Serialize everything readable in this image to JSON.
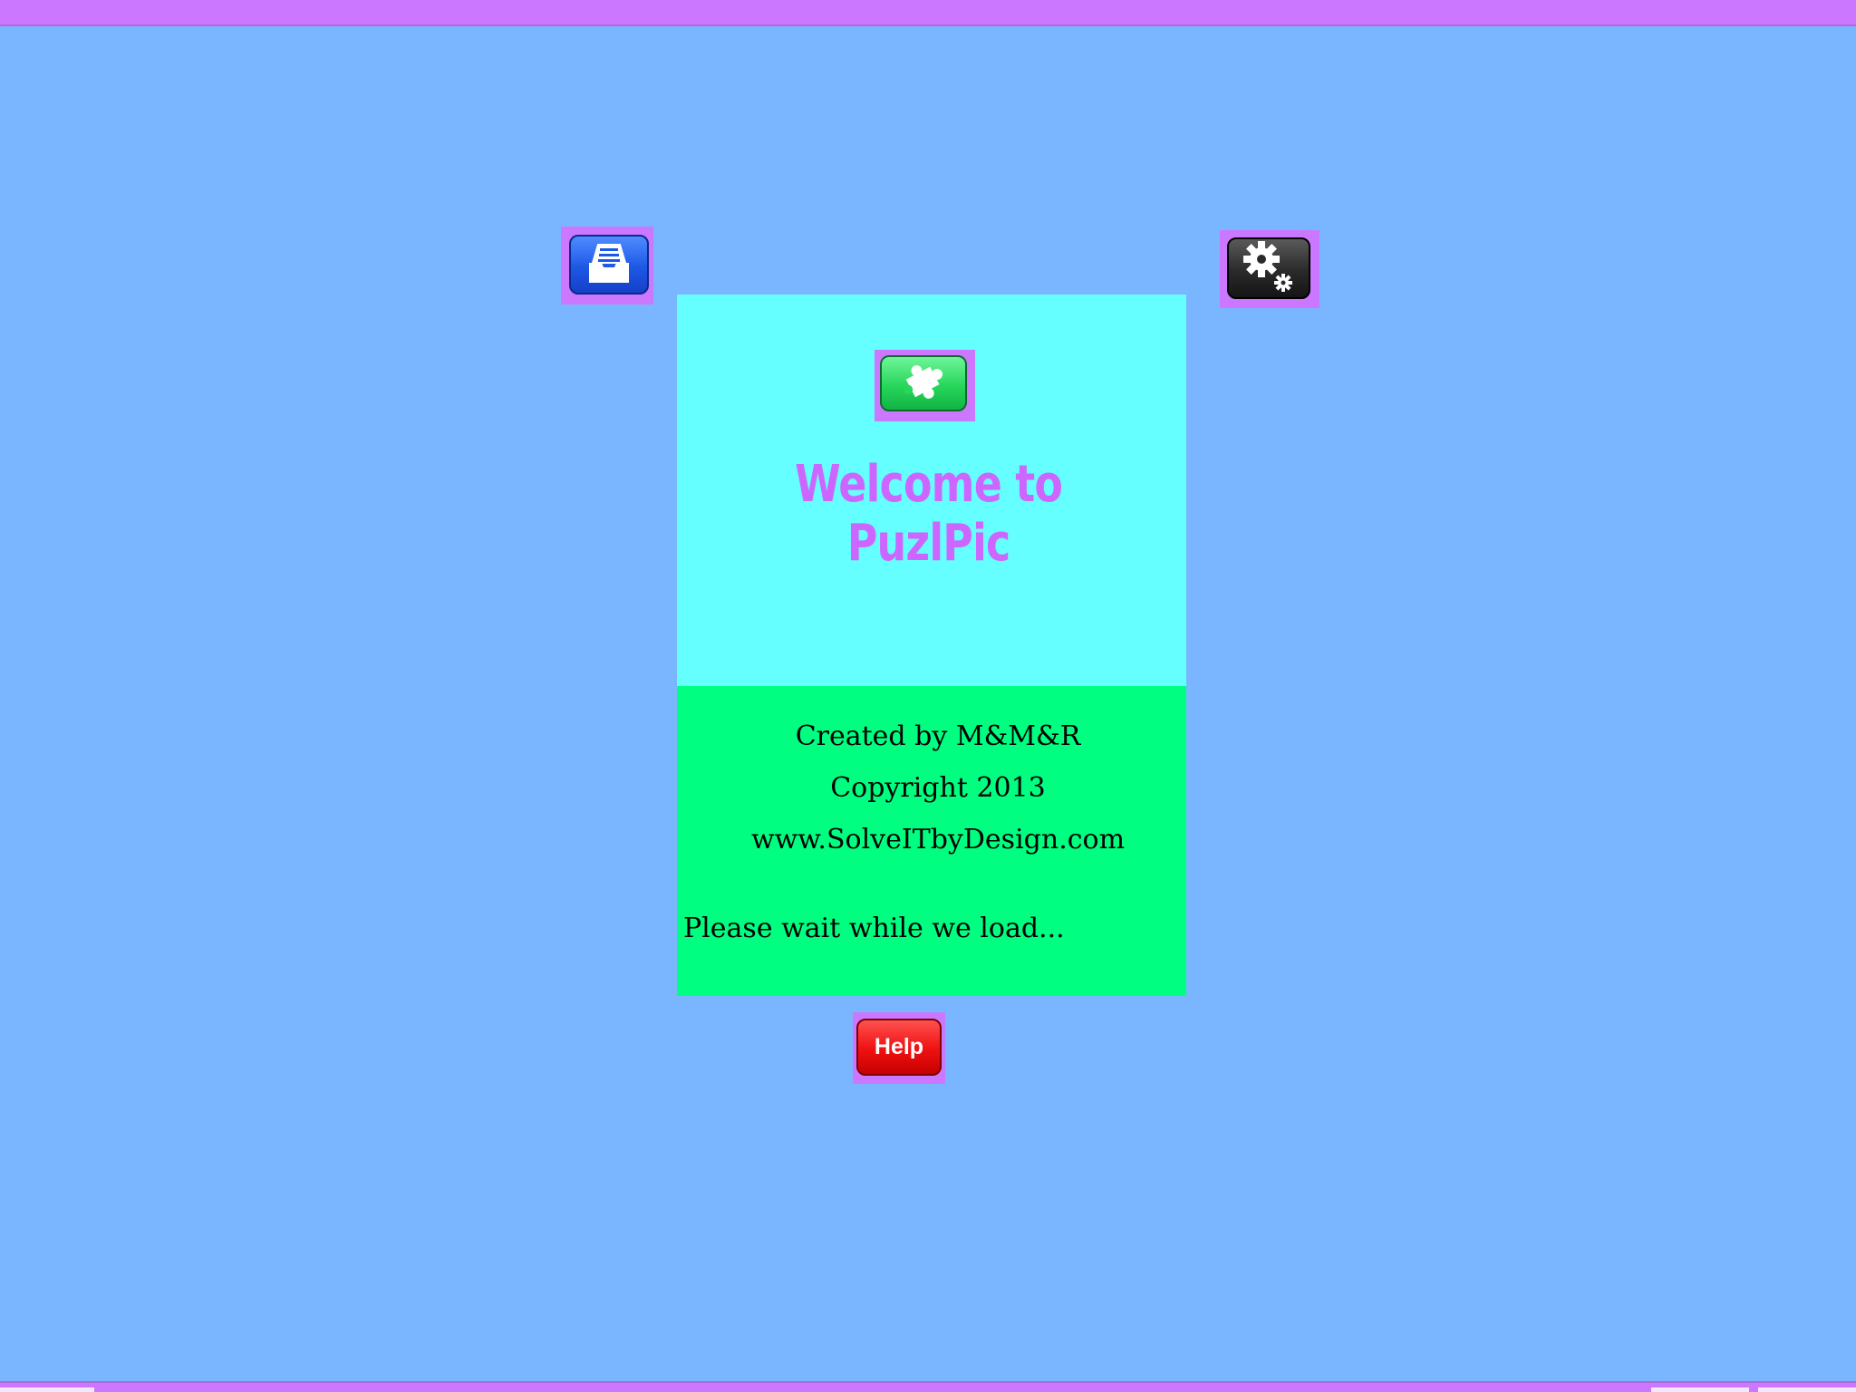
{
  "app": {
    "welcome_title": "Welcome to PuzlPic",
    "credits": {
      "created_by": "Created by M&M&R",
      "copyright": "Copyright 2013",
      "website": "www.SolveITbyDesign.com"
    },
    "loading_text": "Please wait while we load..."
  },
  "buttons": {
    "help_label": "Help",
    "inbox_icon": "inbox-tray-icon",
    "settings_icon": "gears-icon",
    "puzzle_icon": "puzzle-piece-icon"
  },
  "colors": {
    "background": "#7ab5ff",
    "bars": "#cc77ff",
    "panel_top": "#66ffff",
    "panel_bottom": "#00ff80",
    "title": "#cc66ff",
    "help_button": "#ee1111",
    "puzzle_button": "#27d65a",
    "inbox_button": "#1d58e6",
    "settings_button": "#2a2a2a"
  }
}
